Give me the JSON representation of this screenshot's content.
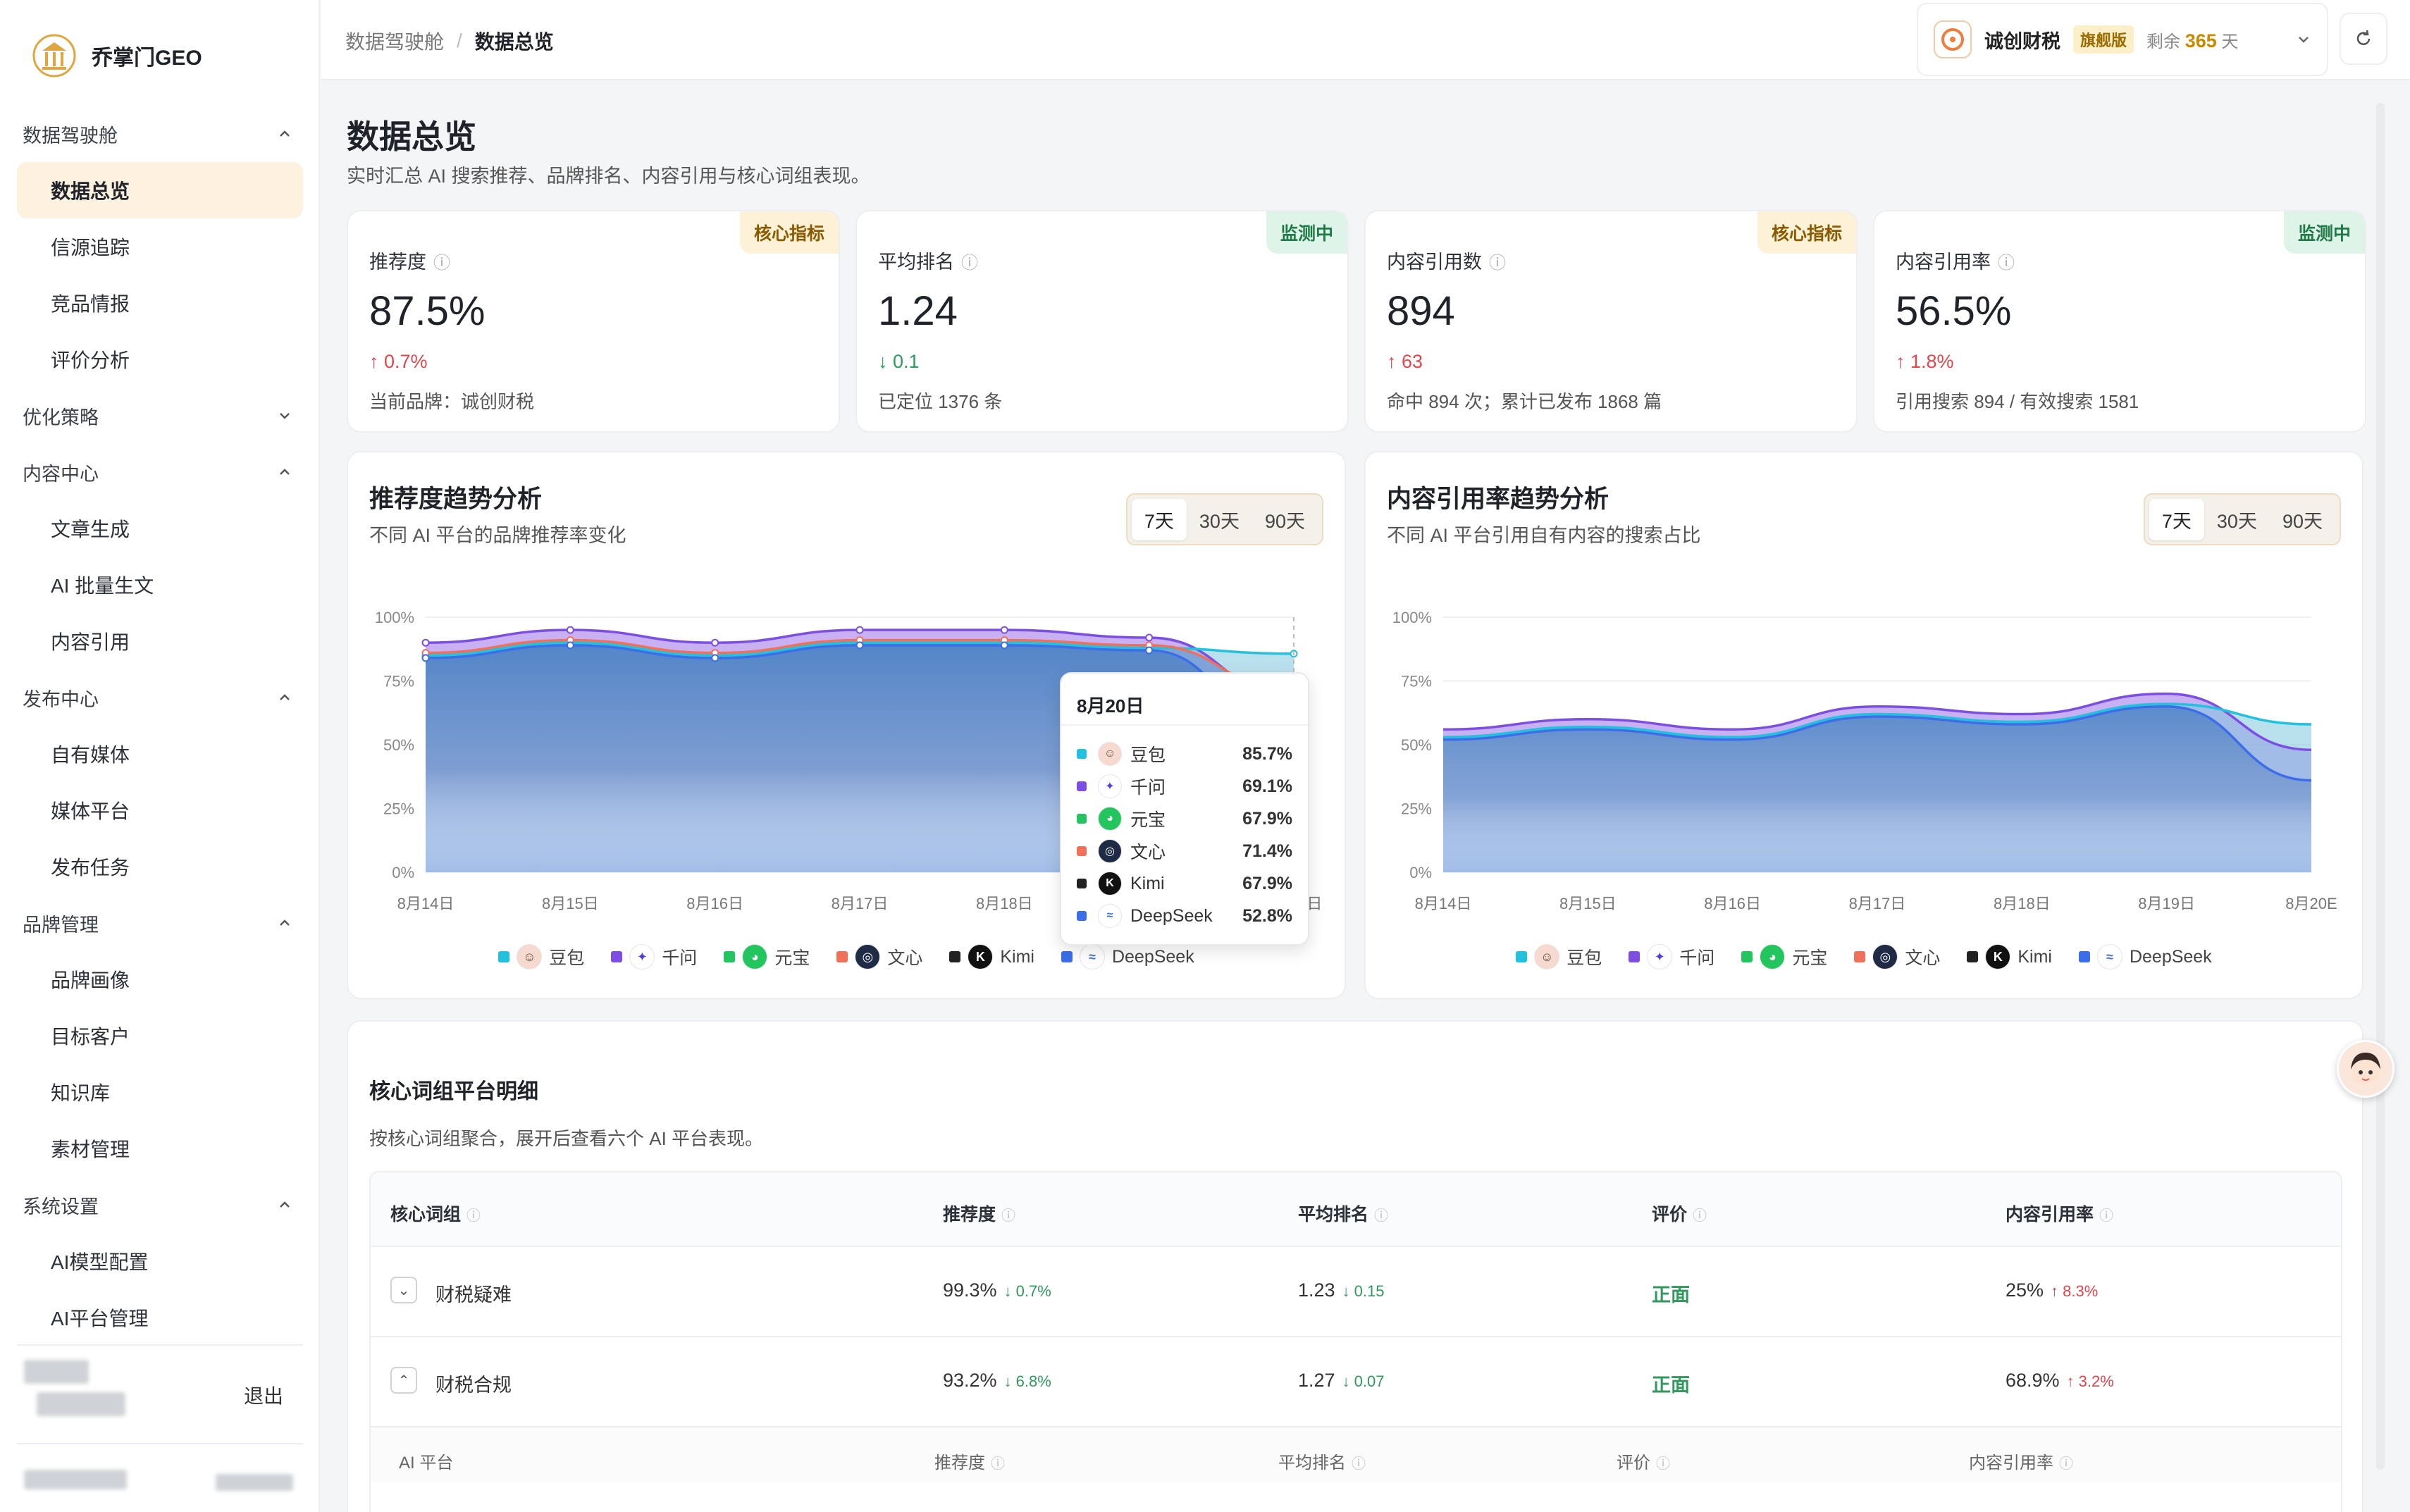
{
  "brand": {
    "name": "乔掌门GEO"
  },
  "sidebar": {
    "groups": [
      {
        "label": "数据驾驶舱",
        "items": [
          "数据总览",
          "信源追踪",
          "竞品情报",
          "评价分析"
        ]
      },
      {
        "label": "优化策略",
        "items": []
      },
      {
        "label": "内容中心",
        "items": [
          "文章生成",
          "AI 批量生文",
          "内容引用"
        ]
      },
      {
        "label": "发布中心",
        "items": [
          "自有媒体",
          "媒体平台",
          "发布任务"
        ]
      },
      {
        "label": "品牌管理",
        "items": [
          "品牌画像",
          "目标客户",
          "知识库",
          "素材管理"
        ]
      },
      {
        "label": "系统设置",
        "items": [
          "AI模型配置",
          "AI平台管理"
        ]
      }
    ],
    "active": "数据总览",
    "logout": "退出"
  },
  "header": {
    "breadcrumb": [
      "数据驾驶舱",
      "数据总览"
    ],
    "account": {
      "name": "诚创财税",
      "badge": "旗舰版",
      "remain_prefix": "剩余",
      "remain_days": "365",
      "remain_unit": "天"
    }
  },
  "page": {
    "title": "数据总览",
    "subtitle": "实时汇总 AI 搜索推荐、品牌排名、内容引用与核心词组表现。"
  },
  "kpis": [
    {
      "label": "推荐度",
      "tag": "核心指标",
      "value": "87.5%",
      "delta": "↑ 0.7%",
      "dir": "up",
      "note": "当前品牌：诚创财税"
    },
    {
      "label": "平均排名",
      "tag": "监测中",
      "value": "1.24",
      "delta": "↓ 0.1",
      "dir": "down",
      "note": "已定位 1376 条"
    },
    {
      "label": "内容引用数",
      "tag": "核心指标",
      "value": "894",
      "delta": "↑ 63",
      "dir": "up",
      "note": "命中 894 次；累计已发布 1868 篇"
    },
    {
      "label": "内容引用率",
      "tag": "监测中",
      "value": "56.5%",
      "delta": "↑ 1.8%",
      "dir": "up",
      "note": "引用搜索 894 / 有效搜索 1581"
    }
  ],
  "ranges": [
    "7天",
    "30天",
    "90天"
  ],
  "platforms": [
    {
      "name": "豆包",
      "color": "#22c1dd"
    },
    {
      "name": "千问",
      "color": "#7c4ee4"
    },
    {
      "name": "元宝",
      "color": "#22c55e"
    },
    {
      "name": "文心",
      "color": "#f0705a"
    },
    {
      "name": "Kimi",
      "color": "#222222"
    },
    {
      "name": "DeepSeek",
      "color": "#3b6ee8"
    }
  ],
  "chart_data": [
    {
      "type": "area",
      "title": "推荐度趋势分析",
      "subtitle": "不同 AI 平台的品牌推荐率变化",
      "x": [
        "8月14日",
        "8月15日",
        "8月16日",
        "8月17日",
        "8月18日",
        "8月19日",
        "8月20日"
      ],
      "yticks": [
        "100%",
        "75%",
        "50%",
        "25%",
        "0%"
      ],
      "ylim": [
        0,
        100
      ],
      "series": [
        {
          "name": "千问",
          "values": [
            90,
            95,
            90,
            95,
            95,
            92,
            69.1
          ]
        },
        {
          "name": "豆包",
          "values": [
            85,
            90,
            85,
            90,
            90,
            88,
            85.7
          ]
        },
        {
          "name": "文心",
          "values": [
            86,
            91,
            86,
            91,
            91,
            89,
            71.4
          ]
        },
        {
          "name": "DeepSeek",
          "values": [
            84,
            89,
            84,
            89,
            89,
            87,
            52.8
          ]
        }
      ],
      "tooltip": {
        "date": "8月20日",
        "rows": [
          {
            "name": "豆包",
            "value": "85.7%"
          },
          {
            "name": "千问",
            "value": "69.1%"
          },
          {
            "name": "元宝",
            "value": "67.9%"
          },
          {
            "name": "文心",
            "value": "71.4%"
          },
          {
            "name": "Kimi",
            "value": "67.9%"
          },
          {
            "name": "DeepSeek",
            "value": "52.8%"
          }
        ]
      }
    },
    {
      "type": "area",
      "title": "内容引用率趋势分析",
      "subtitle": "不同 AI 平台引用自有内容的搜索占比",
      "x": [
        "8月14日",
        "8月15日",
        "8月16日",
        "8月17日",
        "8月18日",
        "8月19日",
        "8月20E"
      ],
      "yticks": [
        "100%",
        "75%",
        "50%",
        "25%",
        "0%"
      ],
      "ylim": [
        0,
        100
      ],
      "series": [
        {
          "name": "千问",
          "values": [
            56,
            60,
            56,
            65,
            62,
            70,
            48
          ]
        },
        {
          "name": "豆包",
          "values": [
            53,
            57,
            53,
            62,
            59,
            66,
            58
          ]
        },
        {
          "name": "DeepSeek",
          "values": [
            52,
            56,
            52,
            61,
            58,
            65,
            36
          ]
        }
      ]
    }
  ],
  "table": {
    "title": "核心词组平台明细",
    "subtitle": "按核心词组聚合，展开后查看六个 AI 平台表现。",
    "headers": [
      "核心词组",
      "推荐度",
      "平均排名",
      "评价",
      "内容引用率"
    ],
    "rows": [
      {
        "name": "财税疑难",
        "rec": "99.3%",
        "rec_d": "↓ 0.7%",
        "rank": "1.23",
        "rank_d": "↓ 0.15",
        "eval": "正面",
        "cite": "25%",
        "cite_d": "↑ 8.3%",
        "expanded": false
      },
      {
        "name": "财税合规",
        "rec": "93.2%",
        "rec_d": "↓ 6.8%",
        "rank": "1.27",
        "rank_d": "↓ 0.07",
        "eval": "正面",
        "cite": "68.9%",
        "cite_d": "↑ 3.2%",
        "expanded": true
      }
    ],
    "subheaders": [
      "AI 平台",
      "推荐度",
      "平均排名",
      "评价",
      "内容引用率"
    ]
  }
}
